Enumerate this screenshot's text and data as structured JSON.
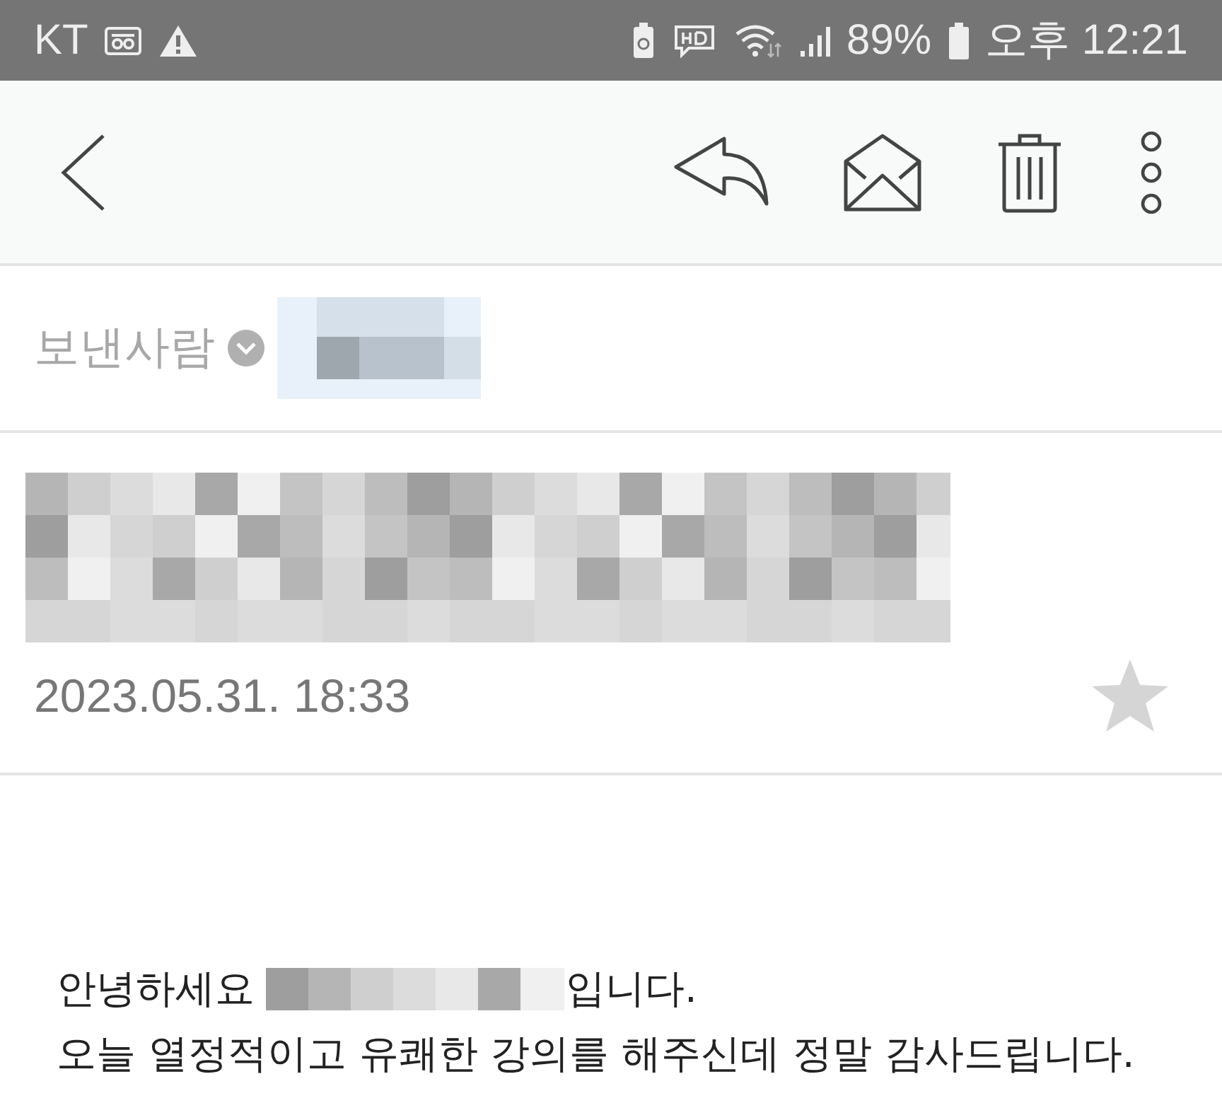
{
  "status_bar": {
    "carrier": "KT",
    "battery": "89%",
    "time": "오후 12:21"
  },
  "sender": {
    "label": "보낸사람"
  },
  "mail": {
    "date": "2023.05.31. 18:33",
    "starred": false
  },
  "body": {
    "greeting_start": "안녕하세요",
    "greeting_end": "입니다.",
    "line_2": "오늘 열정적이고 유쾌한 강의를 해주신데 정말 감사드립니다."
  }
}
